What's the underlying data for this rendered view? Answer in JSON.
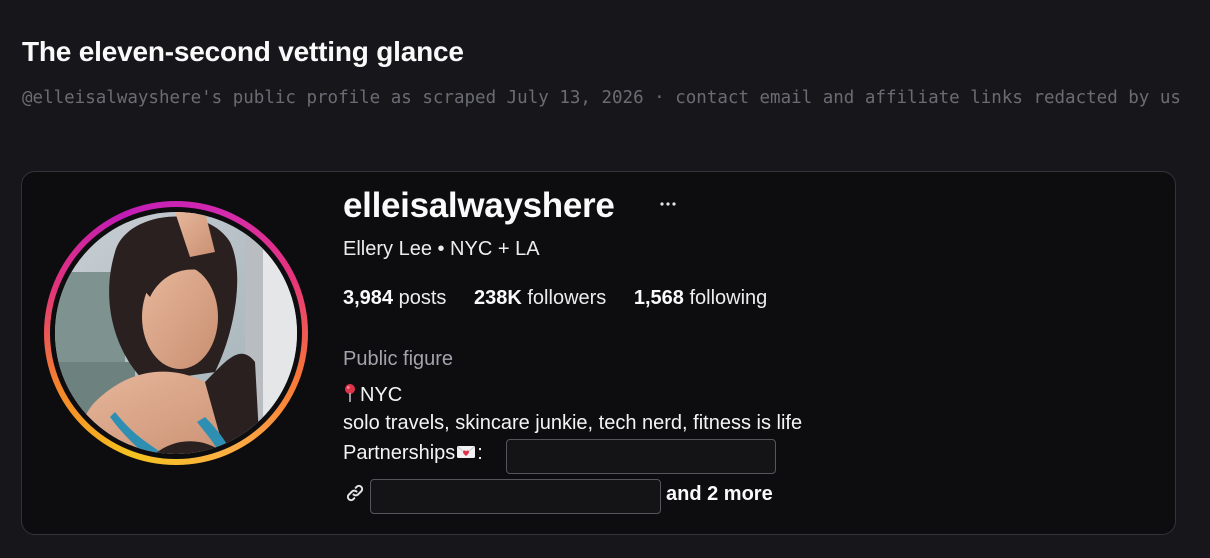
{
  "page": {
    "title": "The eleven-second vetting glance",
    "subtitle": "@elleisalwayshere's public profile as scraped July 13, 2026 · contact email and affiliate links redacted by us"
  },
  "profile": {
    "username": "elleisalwayshere",
    "more_icon": "ellipsis-icon",
    "full_name": "Ellery Lee • NYC + LA",
    "stats": {
      "posts_value": "3,984",
      "posts_label": "posts",
      "followers_value": "238K",
      "followers_label": "followers",
      "following_value": "1,568",
      "following_label": "following"
    },
    "category": "Public figure",
    "bio": {
      "location_icon": "pushpin-icon",
      "location": "NYC",
      "tagline": "solo travels, skincare junkie, tech nerd, fitness is life",
      "partnerships_label": "Partnerships",
      "partnerships_icon": "love-letter-icon",
      "partnerships_suffix": ":"
    },
    "links": {
      "link_icon": "link-icon",
      "more_label": "and 2 more"
    }
  },
  "colors": {
    "background": "#17171b",
    "card": "#0d0d10",
    "card_border": "#333338",
    "subtitle_text": "#6b6b74",
    "ring_gradient": [
      "#f4c31f",
      "#f58529",
      "#e2337a",
      "#c21cb6"
    ]
  }
}
